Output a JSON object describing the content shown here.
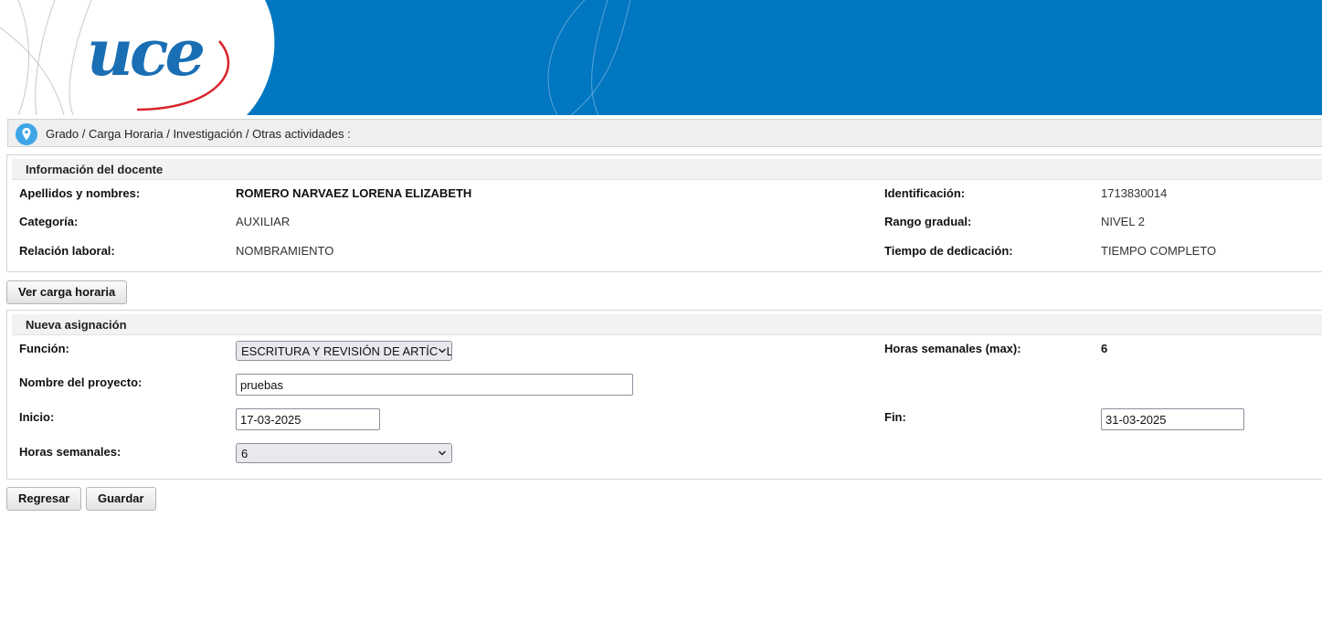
{
  "header": {
    "logo_text": "uce"
  },
  "breadcrumb": {
    "icon": "location-pin-icon",
    "text": "Grado / Carga Horaria / Investigación / Otras actividades :"
  },
  "docente": {
    "title": "Información del docente",
    "labels": {
      "nombres": "Apellidos y nombres:",
      "categoria": "Categoría:",
      "relacion": "Relación laboral:",
      "identificacion": "Identificación:",
      "rango": "Rango gradual:",
      "tiempo": "Tiempo de dedicación:"
    },
    "values": {
      "nombres": "ROMERO NARVAEZ LORENA ELIZABETH",
      "categoria": "AUXILIAR",
      "relacion": "NOMBRAMIENTO",
      "identificacion": "1713830014",
      "rango": "NIVEL 2",
      "tiempo": "TIEMPO COMPLETO"
    }
  },
  "ver_carga_button": "Ver carga horaria",
  "asignacion": {
    "title": "Nueva asignación",
    "labels": {
      "funcion": "Función:",
      "horas_max": "Horas semanales (max):",
      "proyecto": "Nombre del proyecto:",
      "inicio": "Inicio:",
      "fin": "Fin:",
      "horas": "Horas semanales:"
    },
    "values": {
      "funcion_selected": "ESCRITURA Y REVISIÓN DE ARTÍCULOS",
      "horas_max": "6",
      "proyecto": "pruebas",
      "inicio": "17-03-2025",
      "fin": "31-03-2025",
      "horas_selected": "6"
    }
  },
  "buttons": {
    "regresar": "Regresar",
    "guardar": "Guardar"
  }
}
